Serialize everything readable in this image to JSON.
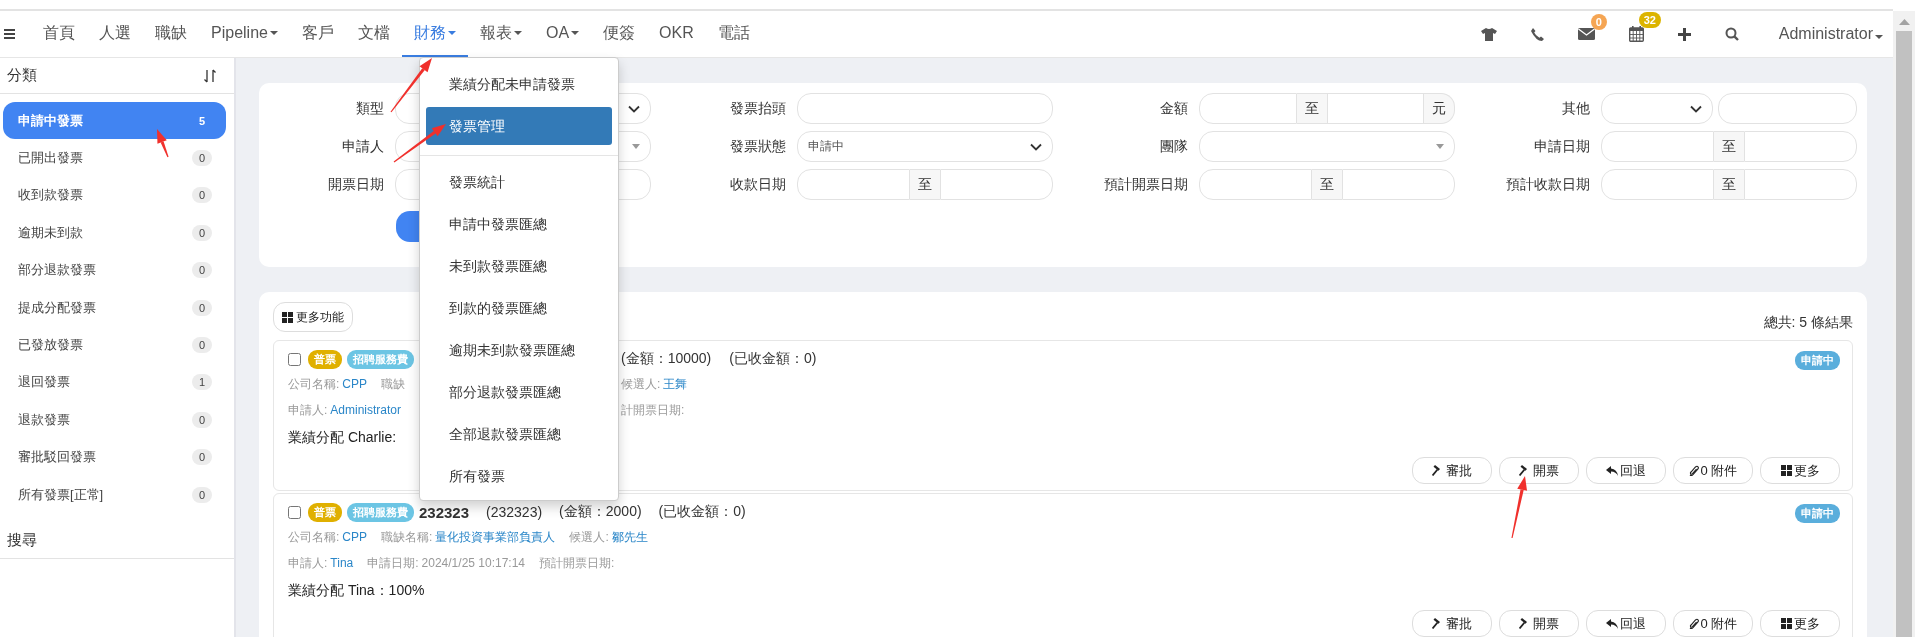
{
  "nav": {
    "items": [
      {
        "label": "首頁",
        "selected": false,
        "dropdown": false
      },
      {
        "label": "人選",
        "selected": false,
        "dropdown": false
      },
      {
        "label": "職缺",
        "selected": false,
        "dropdown": false
      },
      {
        "label": "Pipeline",
        "selected": false,
        "dropdown": true
      },
      {
        "label": "客戶",
        "selected": false,
        "dropdown": false
      },
      {
        "label": "文檔",
        "selected": false,
        "dropdown": false
      },
      {
        "label": "財務",
        "selected": true,
        "dropdown": true
      },
      {
        "label": "報表",
        "selected": false,
        "dropdown": true
      },
      {
        "label": "OA",
        "selected": false,
        "dropdown": true
      },
      {
        "label": "便簽",
        "selected": false,
        "dropdown": false
      },
      {
        "label": "OKR",
        "selected": false,
        "dropdown": false
      },
      {
        "label": "電話",
        "selected": false,
        "dropdown": false
      }
    ],
    "mail_badge": "0",
    "calendar_badge": "32",
    "user": "Administrator"
  },
  "sidebar": {
    "title": "分類",
    "items": [
      {
        "label": "申請中發票",
        "count": "5",
        "selected": true
      },
      {
        "label": "已開出發票",
        "count": "0",
        "selected": false
      },
      {
        "label": "收到款發票",
        "count": "0",
        "selected": false
      },
      {
        "label": "逾期未到款",
        "count": "0",
        "selected": false
      },
      {
        "label": "部分退款發票",
        "count": "0",
        "selected": false
      },
      {
        "label": "提成分配發票",
        "count": "0",
        "selected": false
      },
      {
        "label": "已發放發票",
        "count": "0",
        "selected": false
      },
      {
        "label": "退回發票",
        "count": "1",
        "selected": false
      },
      {
        "label": "退款發票",
        "count": "0",
        "selected": false
      },
      {
        "label": "審批駁回發票",
        "count": "0",
        "selected": false
      },
      {
        "label": "所有發票[正常]",
        "count": "0",
        "selected": false
      }
    ],
    "search_heading": "搜尋"
  },
  "filters": [
    {
      "label": "類型",
      "kind": "select"
    },
    {
      "label": "發票抬頭",
      "kind": "text"
    },
    {
      "label": "金額",
      "kind": "range",
      "separator": "至",
      "unit": "元"
    },
    {
      "label": "其他",
      "kind": "select_text"
    },
    {
      "label": "申請人",
      "kind": "combo"
    },
    {
      "label": "發票狀態",
      "kind": "select",
      "value": "申請中"
    },
    {
      "label": "團隊",
      "kind": "combo"
    },
    {
      "label": "申請日期",
      "kind": "range",
      "separator": "至"
    },
    {
      "label": "開票日期",
      "kind": "range"
    },
    {
      "label": "收款日期",
      "kind": "range",
      "separator": "至"
    },
    {
      "label": "預計開票日期",
      "kind": "range",
      "separator": "至"
    },
    {
      "label": "預計收款日期",
      "kind": "range",
      "separator": "至"
    }
  ],
  "menu": [
    {
      "kind": "item",
      "label": "業績分配未申請發票",
      "selected": false
    },
    {
      "kind": "item",
      "label": "發票管理",
      "selected": true
    },
    {
      "kind": "divider"
    },
    {
      "kind": "item",
      "label": "發票統計",
      "selected": false
    },
    {
      "kind": "item",
      "label": "申請中發票匯總",
      "selected": false
    },
    {
      "kind": "item",
      "label": "未到款發票匯總",
      "selected": false
    },
    {
      "kind": "item",
      "label": "到款的發票匯總",
      "selected": false
    },
    {
      "kind": "item",
      "label": "逾期未到款發票匯總",
      "selected": false
    },
    {
      "kind": "item",
      "label": "部分退款發票匯總",
      "selected": false
    },
    {
      "kind": "item",
      "label": "全部退款發票匯總",
      "selected": false
    },
    {
      "kind": "item",
      "label": "所有發票",
      "selected": false
    }
  ],
  "results": {
    "more_button": "更多功能",
    "total": "總共: 5 條結果",
    "invoices": [
      {
        "checked": false,
        "tags": [
          {
            "text": "普票",
            "color": "#e0b000"
          },
          {
            "text": "招聘服務費",
            "color": "#6cc5e4"
          }
        ],
        "status": "申請中",
        "head": {
          "right": [
            "(金額：10000)",
            "(已收金額：0)"
          ]
        },
        "meta": [
          {
            "left": [
              {
                "label": "公司名稱:",
                "value": "CPP",
                "link": true
              },
              {
                "label": "職缺"
              }
            ],
            "right": [
              {
                "label": "候選人:",
                "value": "王舞",
                "link": true
              }
            ]
          },
          {
            "left": [
              {
                "label": "申請人:",
                "value": "Administrator",
                "link": true
              }
            ],
            "right": [
              {
                "label": "計開票日期:"
              }
            ]
          }
        ],
        "note": "業績分配 Charlie:",
        "actions": [
          {
            "kind": "approve",
            "label": "審批"
          },
          {
            "kind": "issue",
            "label": "開票"
          },
          {
            "kind": "return",
            "label": "回退"
          },
          {
            "kind": "attach",
            "label": "0 附件"
          },
          {
            "kind": "more",
            "label": "更多"
          }
        ]
      },
      {
        "checked": false,
        "tags": [
          {
            "text": "普票",
            "color": "#e0b000"
          },
          {
            "text": "招聘服務費",
            "color": "#6cc5e4"
          }
        ],
        "status": "申請中",
        "head": {
          "number": "232323",
          "left": [
            "(232323)",
            "(金額：2000)",
            "(已收金額：0)"
          ]
        },
        "meta": [
          {
            "left": [
              {
                "label": "公司名稱:",
                "value": "CPP",
                "link": true
              },
              {
                "label": "職缺名稱:",
                "value": "量化投資事業部負責人",
                "link": true
              },
              {
                "label": "候選人:",
                "value": "鄒先生",
                "link": true
              }
            ]
          },
          {
            "left": [
              {
                "label": "申請人:",
                "value": "Tina",
                "link": true
              },
              {
                "label": "申請日期:",
                "value": "2024/1/25 10:17:14",
                "link": false
              },
              {
                "label": "預計開票日期:"
              }
            ]
          }
        ],
        "note": "業績分配 Tina：100%",
        "actions": [
          {
            "kind": "approve",
            "label": "審批"
          },
          {
            "kind": "issue",
            "label": "開票"
          },
          {
            "kind": "return",
            "label": "回退"
          },
          {
            "kind": "attach",
            "label": "0 附件"
          },
          {
            "kind": "more",
            "label": "更多"
          }
        ]
      }
    ]
  }
}
